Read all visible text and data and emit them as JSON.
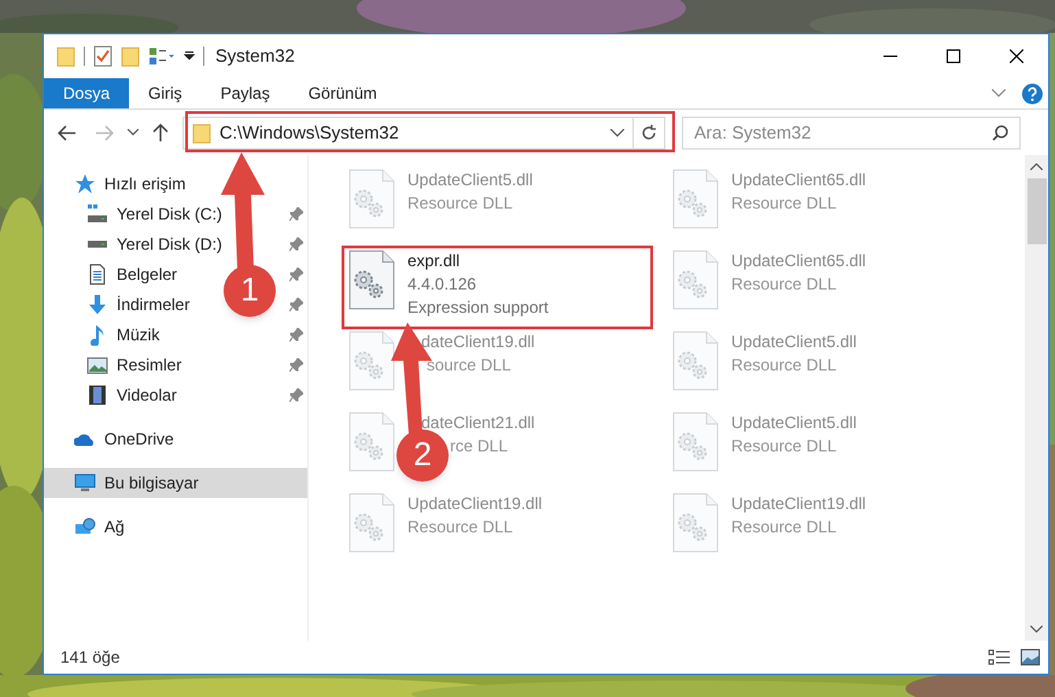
{
  "window": {
    "title": "System32"
  },
  "ribbon_tabs": [
    {
      "label": "Dosya",
      "kind": "file"
    },
    {
      "label": "Giriş",
      "kind": "tab"
    },
    {
      "label": "Paylaş",
      "kind": "tab"
    },
    {
      "label": "Görünüm",
      "kind": "tab"
    }
  ],
  "address": {
    "path": "C:\\Windows\\System32"
  },
  "search": {
    "placeholder": "Ara: System32"
  },
  "sidebar": {
    "items": [
      {
        "label": "Hızlı erişim",
        "selected": false,
        "children": [
          {
            "label": "Yerel Disk (C:)",
            "pinned": true
          },
          {
            "label": "Yerel Disk (D:)",
            "pinned": true
          },
          {
            "label": "Belgeler",
            "pinned": true
          },
          {
            "label": "İndirmeler",
            "pinned": true
          },
          {
            "label": "Müzik",
            "pinned": true
          },
          {
            "label": "Resimler",
            "pinned": true
          },
          {
            "label": "Videolar",
            "pinned": true
          }
        ]
      },
      {
        "label": "OneDrive",
        "selected": false
      },
      {
        "label": "Bu bilgisayar",
        "selected": true
      },
      {
        "label": "Ağ",
        "selected": false
      }
    ]
  },
  "files": [
    {
      "name": "UpdateClient5.dll",
      "details": [
        "Resource DLL"
      ],
      "blurred": true
    },
    {
      "name": "UpdateClient65.dll",
      "details": [
        "Resource DLL"
      ],
      "blurred": true
    },
    {
      "name": "expr.dll",
      "details": [
        "4.4.0.126",
        "Expression support"
      ],
      "blurred": false
    },
    {
      "name": "UpdateClient65.dll",
      "details": [
        "Resource DLL"
      ],
      "blurred": true
    },
    {
      "name": "dateClient19.dll",
      "details": [
        "source DLL"
      ],
      "blurred": true
    },
    {
      "name": "UpdateClient5.dll",
      "details": [
        "Resource DLL"
      ],
      "blurred": true
    },
    {
      "name": "dateClient21.dll",
      "details": [
        "rce DLL"
      ],
      "blurred": true
    },
    {
      "name": "UpdateClient5.dll",
      "details": [
        "Resource DLL"
      ],
      "blurred": true
    },
    {
      "name": "UpdateClient19.dll",
      "details": [
        "Resource DLL"
      ],
      "blurred": true
    },
    {
      "name": "UpdateClient19.dll",
      "details": [
        "Resource DLL"
      ],
      "blurred": true
    }
  ],
  "status_bar": {
    "count": "141 öğe"
  },
  "annotations": [
    {
      "label": "1"
    },
    {
      "label": "2"
    }
  ]
}
